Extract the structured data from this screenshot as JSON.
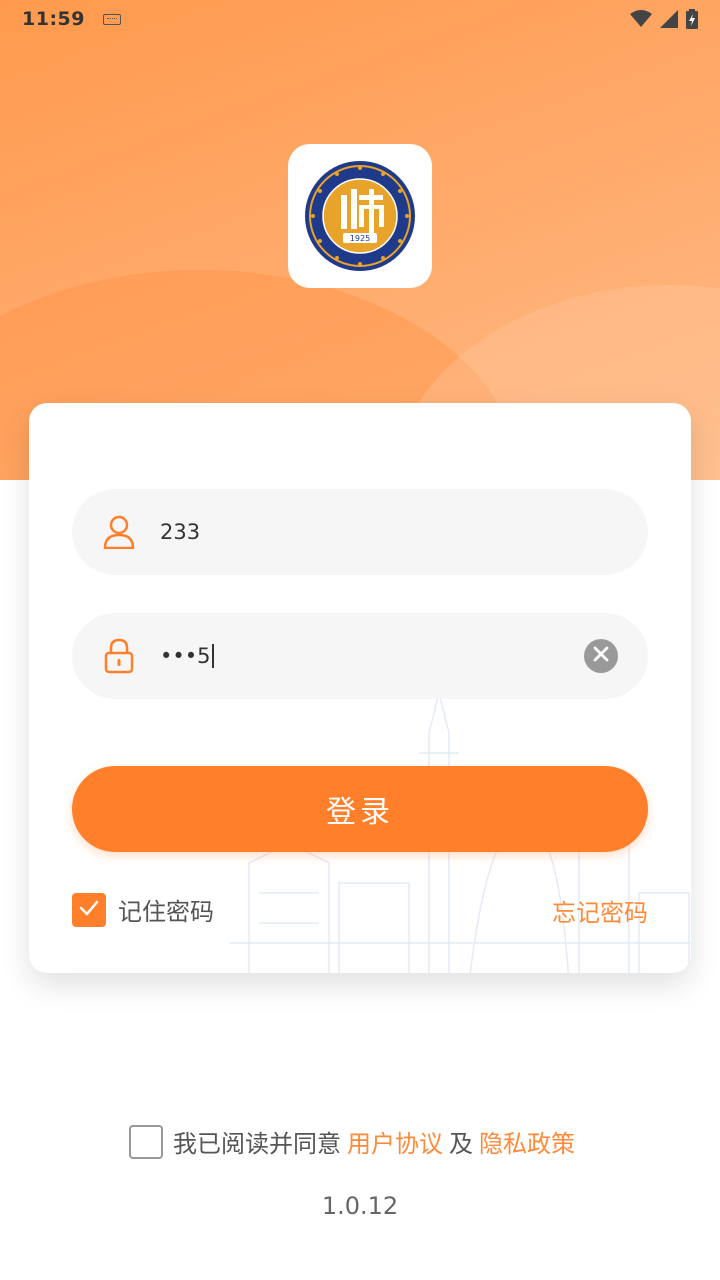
{
  "status_bar": {
    "time": "11:59"
  },
  "login": {
    "username_value": "233",
    "password_display": "•••5",
    "login_label": "登录",
    "remember_label": "记住密码",
    "forgot_label": "忘记密码"
  },
  "agreement": {
    "prefix": "我已阅读并同意",
    "user_agreement": "用户协议",
    "conjunction": "及",
    "privacy_policy": "隐私政策"
  },
  "version": "1.0.12",
  "colors": {
    "accent": "#ff7f2a",
    "link": "#ff8a3a",
    "seal_blue": "#1f3a8a",
    "seal_gold": "#e8a32a"
  },
  "icons": {
    "user": "user-icon",
    "lock": "lock-icon",
    "clear": "clear-icon",
    "check": "check-icon",
    "wifi": "wifi-icon",
    "signal": "signal-icon",
    "battery": "battery-icon",
    "keyboard": "keyboard-icon"
  },
  "logo": {
    "seal_year": "1925",
    "seal_char": "师"
  }
}
